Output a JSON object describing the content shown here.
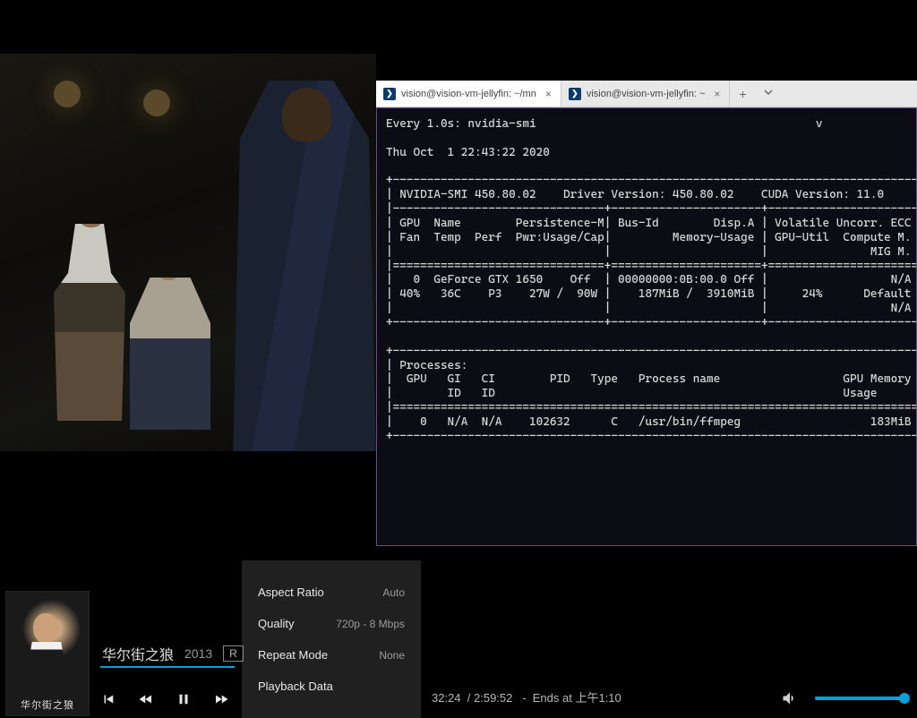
{
  "video_scene": {
    "description": "Film still: three men in an office interior with overhead lamps; man in blue pinstripe suit from behind in foreground"
  },
  "terminal": {
    "tabs": [
      {
        "title": "vision@vision-vm-jellyfin: ~/mn",
        "active": true
      },
      {
        "title": "vision@vision-vm-jellyfin: ~",
        "active": false
      }
    ],
    "watch_header": "Every 1.0s: nvidia-smi",
    "timestamp": "Thu Oct  1 22:43:22 2020",
    "nvsmi": {
      "version_line": "| NVIDIA-SMI 450.80.02    Driver Version: 450.80.02    CUDA Version: 11.0  ",
      "hdr1": "| GPU  Name        Persistence-M| Bus-Id        Disp.A | Volatile Uncorr. ECC ",
      "hdr2": "| Fan  Temp  Perf  Pwr:Usage/Cap|         Memory-Usage | GPU-Util  Compute M. ",
      "hdr3": "|                               |                      |               MIG M. ",
      "gpu1": "|   0  GeForce GTX 1650    Off  | 00000000:0B:00.0 Off |                  N/A ",
      "gpu2": "| 40%   36C    P3    27W /  90W |    187MiB /  3910MiB |     24%      Default ",
      "gpu3": "|                               |                      |                  N/A ",
      "proc_hdr": "| Processes:                                                                   ",
      "proc_cols1": "|  GPU   GI   CI        PID   Type   Process name                  GPU Memory ",
      "proc_cols2": "|        ID   ID                                                   Usage      ",
      "proc_row": "|    0   N/A  N/A    102632      C   /usr/bin/ffmpeg                   183MiB   "
    },
    "sep_top": "+-------------------------------------------------------------------------------",
    "sep_mid": "|-------------------------------+----------------------+-----------------------",
    "sep_eq": "|===============================+======================+=======================",
    "sep_bot": "+-------------------------------+----------------------+-----------------------",
    "sep_full": "+-------------------------------------------------------------------------------",
    "sep_peq": "|===============================================================================",
    "sep_pend": "+-------------------------------------------------------------------------------"
  },
  "settings": {
    "rows": [
      {
        "label": "Aspect Ratio",
        "value": "Auto"
      },
      {
        "label": "Quality",
        "value": "720p - 8 Mbps"
      },
      {
        "label": "Repeat Mode",
        "value": "None"
      },
      {
        "label": "Playback Data",
        "value": ""
      }
    ]
  },
  "media": {
    "poster_caption": "华尔街之狼",
    "title": "华尔街之狼",
    "year": "2013",
    "rating": "R"
  },
  "playback": {
    "current": "32:24",
    "total": "2:59:52",
    "ends_label": "Ends at 上午1:10"
  }
}
